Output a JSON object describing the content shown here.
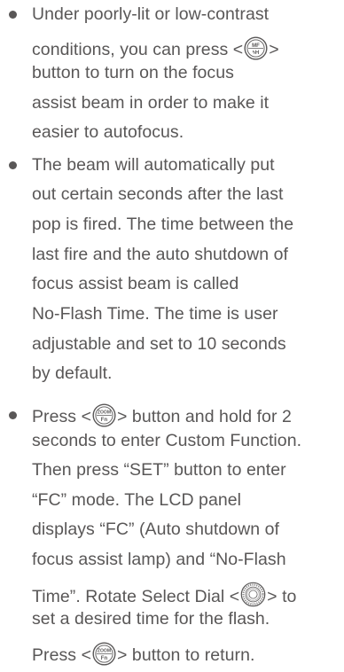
{
  "bullets": [
    {
      "segments": {
        "l1": "Under poorly-lit or low-contrast",
        "l2a": "conditions, you can press <",
        "l2b": ">",
        "l3": "button to turn on the focus",
        "l4": "assist beam in order to make it",
        "l5": "easier to autofocus."
      },
      "icon": "mf-4h-button-icon"
    },
    {
      "segments": {
        "l1": "The beam will automatically put",
        "l2": "out certain seconds after the last",
        "l3": "pop is fired. The time between the",
        "l4": "last fire and the auto shutdown of",
        "l5": "focus assist beam is called",
        "l6": "No-Flash Time. The time is user",
        "l7": "adjustable and set to 10 seconds",
        "l8": "by default."
      }
    },
    {
      "segments": {
        "l1a": "Press <",
        "l1b": "> button and hold for 2",
        "l2": "seconds to enter Custom Function.",
        "l3": "Then press “SET” button to enter",
        "l4": "“FC” mode. The LCD panel",
        "l5": "displays “FC” (Auto shutdown of",
        "l6": "focus assist lamp) and “No-Flash",
        "l7a": "Time”. Rotate Select Dial <",
        "l7b": "> to",
        "l8": "set a desired time for the flash.",
        "l9a": "Press <",
        "l9b": "> button to return."
      },
      "icons": [
        "zoom-fn-button-icon",
        "select-dial-icon"
      ]
    }
  ],
  "icon_labels": {
    "mf_top": "MF",
    "mf_bottom": "ϟH",
    "zoom_top": "ZOOM",
    "zoom_bottom": "Fn"
  },
  "colors": {
    "text": "#595757",
    "icon_stroke": "#595757"
  }
}
